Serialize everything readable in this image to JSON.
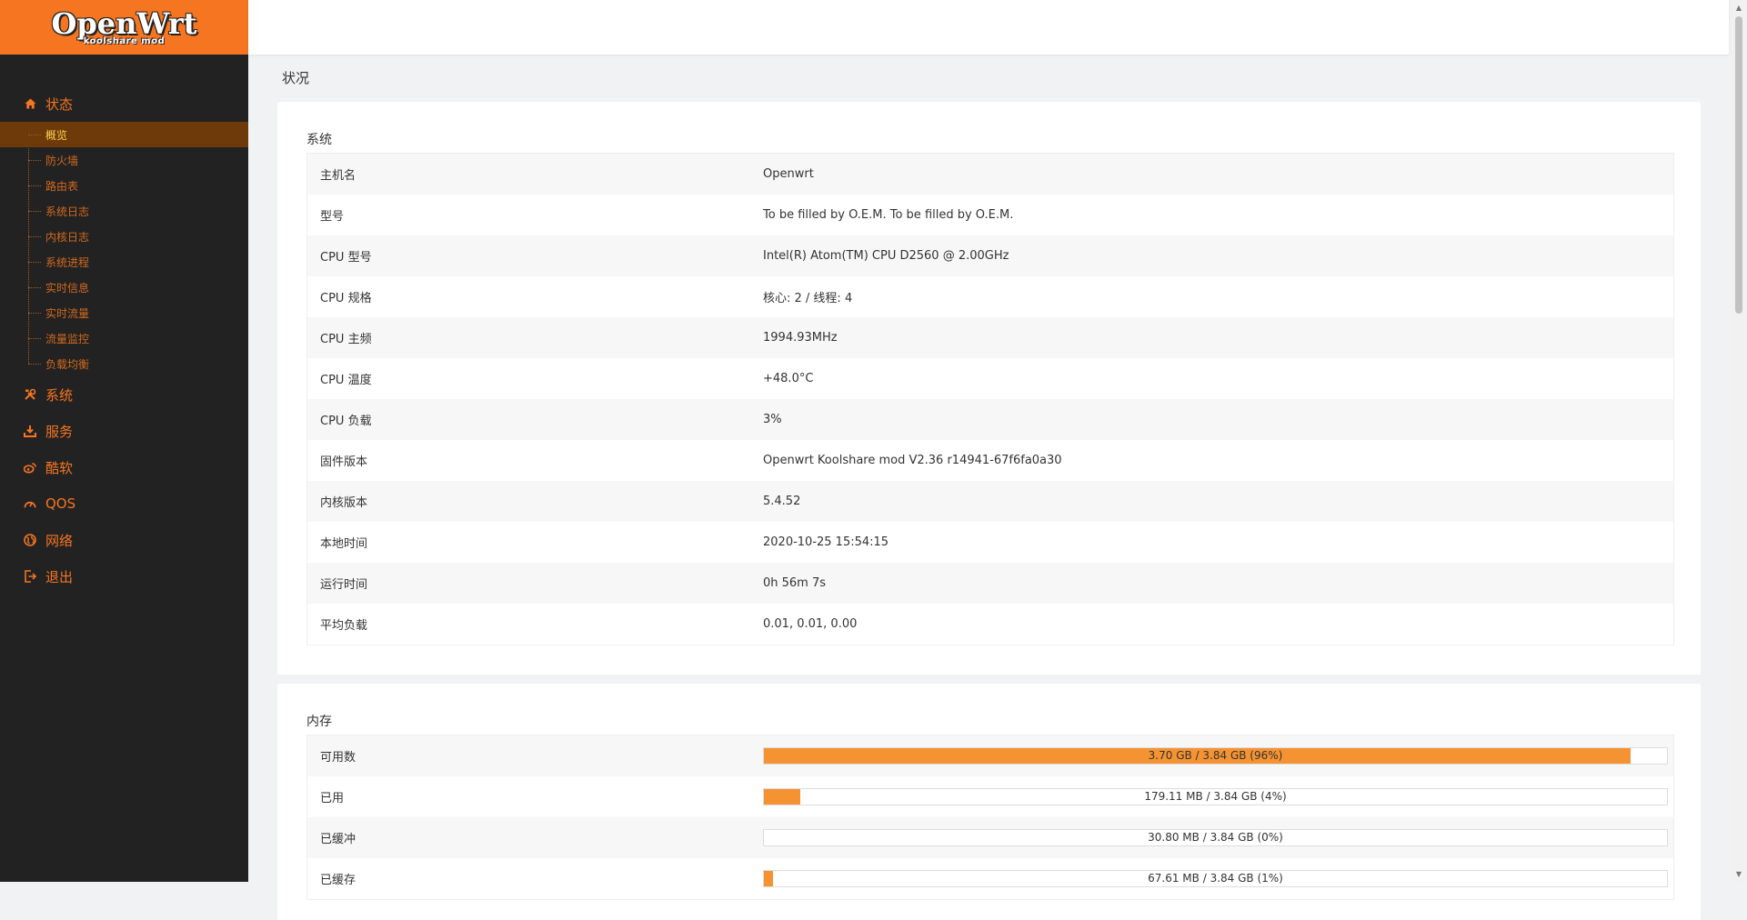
{
  "brand": {
    "name": "OpenWrt",
    "sub": "koolshare mod",
    "accent": "#f57520"
  },
  "nav": {
    "status": {
      "label": "状态",
      "icon": "home-icon"
    },
    "status_items": [
      "概览",
      "防火墙",
      "路由表",
      "系统日志",
      "内核日志",
      "系统进程",
      "实时信息",
      "实时流量",
      "流量监控",
      "负载均衡"
    ],
    "active_item": "概览",
    "groups": [
      {
        "label": "系统",
        "icon": "tools-icon"
      },
      {
        "label": "服务",
        "icon": "download-icon"
      },
      {
        "label": "酷软",
        "icon": "weibo-icon"
      },
      {
        "label": "QOS",
        "icon": "gauge-icon"
      },
      {
        "label": "网络",
        "icon": "globe-icon"
      },
      {
        "label": "退出",
        "icon": "logout-icon"
      }
    ]
  },
  "page": {
    "title": "状况"
  },
  "system": {
    "title": "系统",
    "rows": [
      {
        "key": "主机名",
        "value": "Openwrt"
      },
      {
        "key": "型号",
        "value": "To be filled by O.E.M. To be filled by O.E.M."
      },
      {
        "key": "CPU 型号",
        "value": "Intel(R) Atom(TM) CPU D2560 @ 2.00GHz"
      },
      {
        "key": "CPU 规格",
        "value": "核心: 2 / 线程: 4"
      },
      {
        "key": "CPU 主频",
        "value": "1994.93MHz"
      },
      {
        "key": "CPU 温度",
        "value": "+48.0°C"
      },
      {
        "key": "CPU 负载",
        "value": "3%"
      },
      {
        "key": "固件版本",
        "value": "Openwrt Koolshare mod V2.36 r14941-67f6fa0a30"
      },
      {
        "key": "内核版本",
        "value": "5.4.52"
      },
      {
        "key": "本地时间",
        "value": "2020-10-25 15:54:15"
      },
      {
        "key": "运行时间",
        "value": "0h 56m 7s"
      },
      {
        "key": "平均负载",
        "value": "0.01, 0.01, 0.00"
      }
    ]
  },
  "memory": {
    "title": "内存",
    "rows": [
      {
        "key": "可用数",
        "text": "3.70 GB / 3.84 GB (96%)",
        "percent": 96
      },
      {
        "key": "已用",
        "text": "179.11 MB / 3.84 GB (4%)",
        "percent": 4
      },
      {
        "key": "已缓冲",
        "text": "30.80 MB / 3.84 GB (0%)",
        "percent": 0
      },
      {
        "key": "已缓存",
        "text": "67.61 MB / 3.84 GB (1%)",
        "percent": 1
      }
    ]
  }
}
